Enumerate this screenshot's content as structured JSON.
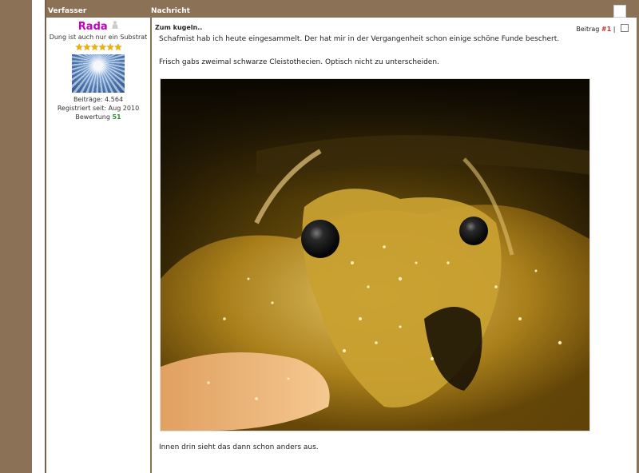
{
  "header": {
    "author_col": "Verfasser",
    "message_col": "Nachricht"
  },
  "author": {
    "name": "Rada",
    "rank": "Dung ist auch nur ein Substrat",
    "stars": "★★★★★★",
    "posts": "Beiträge: 4.564",
    "registered": "Registriert seit: Aug 2010",
    "rating_label": "Bewertung",
    "rating_value": "51"
  },
  "post": {
    "title": "Zum kugeln..",
    "number_label": "Beitrag",
    "number": "#1",
    "separator": "|",
    "text1": "Schafmist hab ich heute eingesammelt. Der hat mir in der Vergangenheit schon einige schöne Funde beschert.",
    "text2": "Frisch gabs zweimal schwarze Cleistothecien. Optisch nicht zu unterscheiden.",
    "text3": "Innen drin sieht das dann schon anders aus."
  },
  "colors": {
    "frame_brown": "#8b7256",
    "username": "#c000c0",
    "rating": "#2e8b2e"
  }
}
